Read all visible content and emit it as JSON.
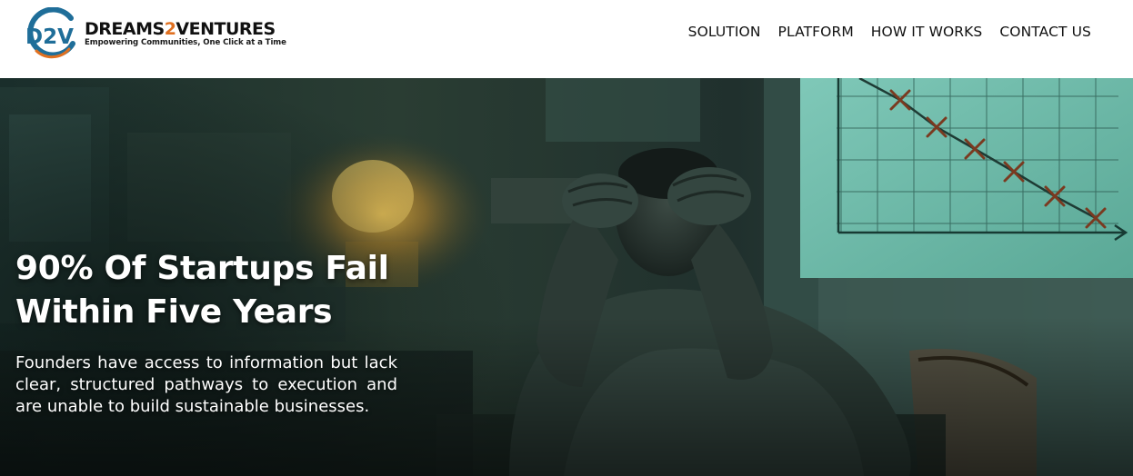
{
  "brand": {
    "mark": "D2V",
    "name_part1": "DREAMS",
    "name_accent": "2",
    "name_part2": "VENTURES",
    "tagline": "Empowering Communities, One Click at a Time"
  },
  "nav": {
    "items": [
      {
        "label": "SOLUTION"
      },
      {
        "label": "PLATFORM"
      },
      {
        "label": "HOW IT WORKS"
      },
      {
        "label": "CONTACT US"
      }
    ]
  },
  "hero": {
    "title_line1": "90% Of Startups Fail",
    "title_line2": "Within Five Years",
    "body": "Founders have access to information but lack clear, structured pathways to execution and are unable to build sustainable businesses.",
    "background_image": "stressed-founder-declining-chart-photo"
  },
  "colors": {
    "brand_accent": "#e07020",
    "brand_blue": "#1f6e99",
    "text_dark": "#111111",
    "hero_tint": "#1c2c2a"
  }
}
